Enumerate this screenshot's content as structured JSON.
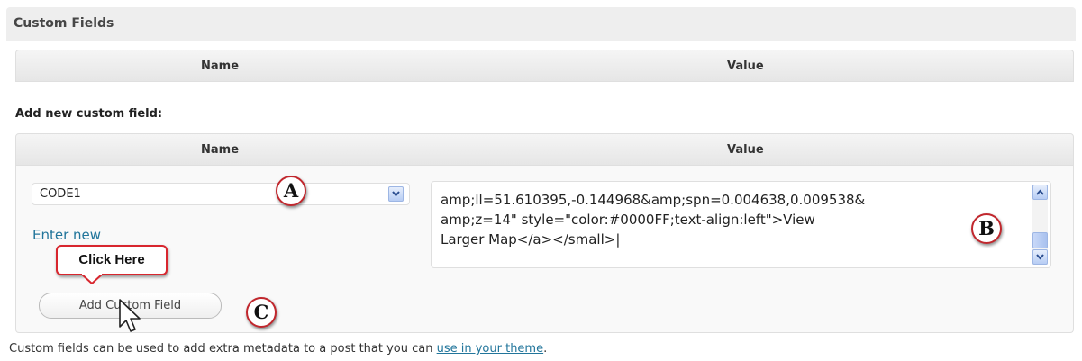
{
  "panel": {
    "title": "Custom Fields"
  },
  "existing_table": {
    "name_header": "Name",
    "value_header": "Value"
  },
  "add_new": {
    "label": "Add new custom field:",
    "name_header": "Name",
    "value_header": "Value",
    "key_select": {
      "selected": "CODE1"
    },
    "enter_new_link": "Enter new",
    "value_text": "amp;ll=51.610395,-0.144968&amp;spn=0.004638,0.009538&\namp;z=14\" style=\"color:#0000FF;text-align:left\">View\nLarger Map</a></small>|",
    "add_button": "Add Custom Field"
  },
  "annotations": {
    "marker_a": "A",
    "marker_b": "B",
    "marker_c": "C",
    "callout": "Click Here"
  },
  "footer": {
    "text_before": "Custom fields can be used to add extra metadata to a post that you can ",
    "link": "use in your theme",
    "text_after": "."
  },
  "colors": {
    "link": "#21759b",
    "annotation_red": "#d8262e"
  },
  "icons": {
    "dropdown": "chevron-down-icon",
    "scroll_up": "chevron-up-icon",
    "scroll_down": "chevron-down-icon",
    "pointer": "mouse-pointer-icon"
  }
}
